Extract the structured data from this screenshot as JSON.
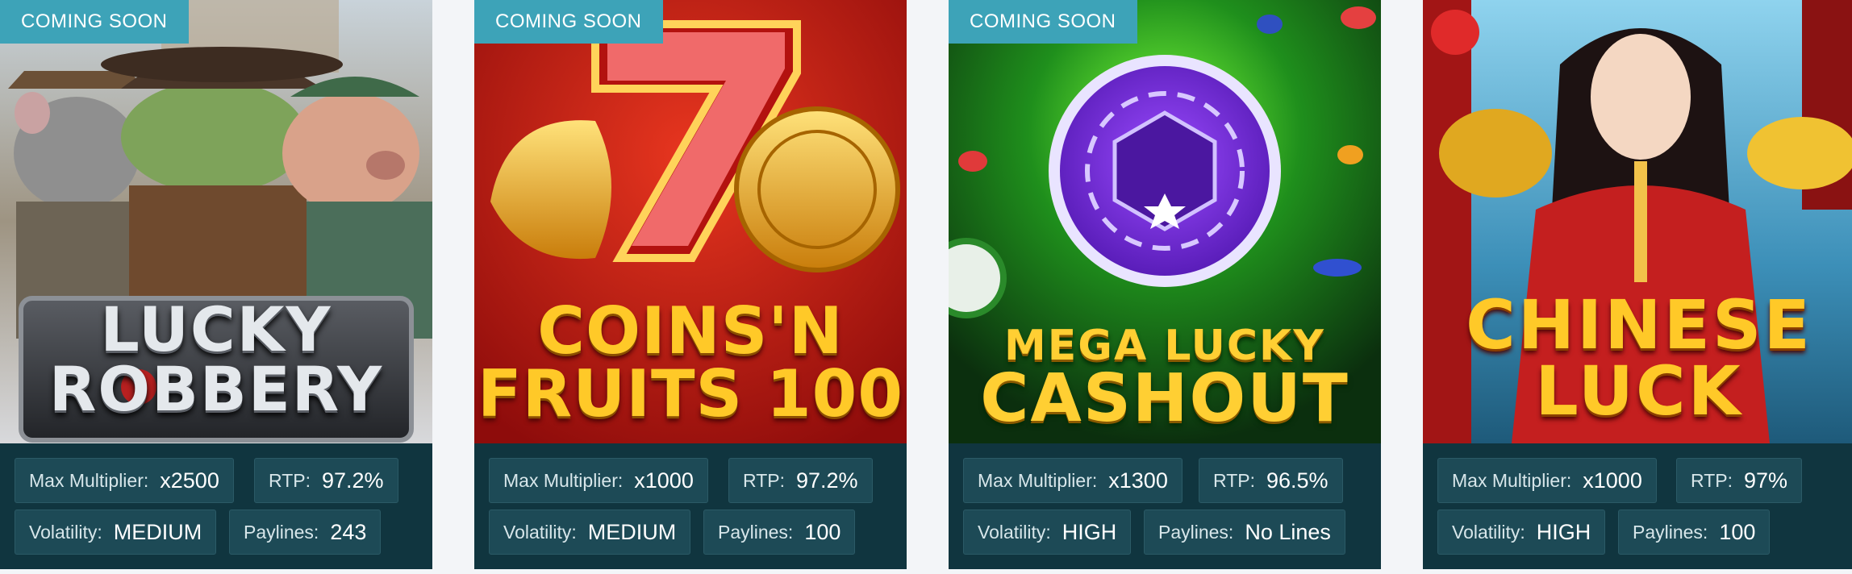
{
  "cards": [
    {
      "badge": "COMING SOON",
      "title_lines": [
        "LUCKY",
        "ROBBERY"
      ],
      "stats": {
        "max_multiplier_label": "Max Multiplier:",
        "max_multiplier": "x2500",
        "rtp_label": "RTP:",
        "rtp": "97.2%",
        "volatility_label": "Volatility:",
        "volatility": "MEDIUM",
        "paylines_label": "Paylines:",
        "paylines": "243"
      }
    },
    {
      "badge": "COMING SOON",
      "title_lines": [
        "COINS'N",
        "FRUITS 100"
      ],
      "stats": {
        "max_multiplier_label": "Max Multiplier:",
        "max_multiplier": "x1000",
        "rtp_label": "RTP:",
        "rtp": "97.2%",
        "volatility_label": "Volatility:",
        "volatility": "MEDIUM",
        "paylines_label": "Paylines:",
        "paylines": "100"
      }
    },
    {
      "badge": "COMING SOON",
      "title_lines": [
        "MEGA LUCKY",
        "CASHOUT"
      ],
      "stats": {
        "max_multiplier_label": "Max Multiplier:",
        "max_multiplier": "x1300",
        "rtp_label": "RTP:",
        "rtp": "96.5%",
        "volatility_label": "Volatility:",
        "volatility": "HIGH",
        "paylines_label": "Paylines:",
        "paylines": "No Lines"
      }
    },
    {
      "title_lines": [
        "CHINESE",
        "LUCK"
      ],
      "stats": {
        "max_multiplier_label": "Max Multiplier:",
        "max_multiplier": "x1000",
        "rtp_label": "RTP:",
        "rtp": "97%",
        "volatility_label": "Volatility:",
        "volatility": "HIGH",
        "paylines_label": "Paylines:",
        "paylines": "100"
      }
    }
  ],
  "colors": {
    "badge_bg": "#3da3b8",
    "panel_bg": "#10353f",
    "chip_bg": "#1d4a56",
    "page_bg": "#f3f5f8"
  }
}
